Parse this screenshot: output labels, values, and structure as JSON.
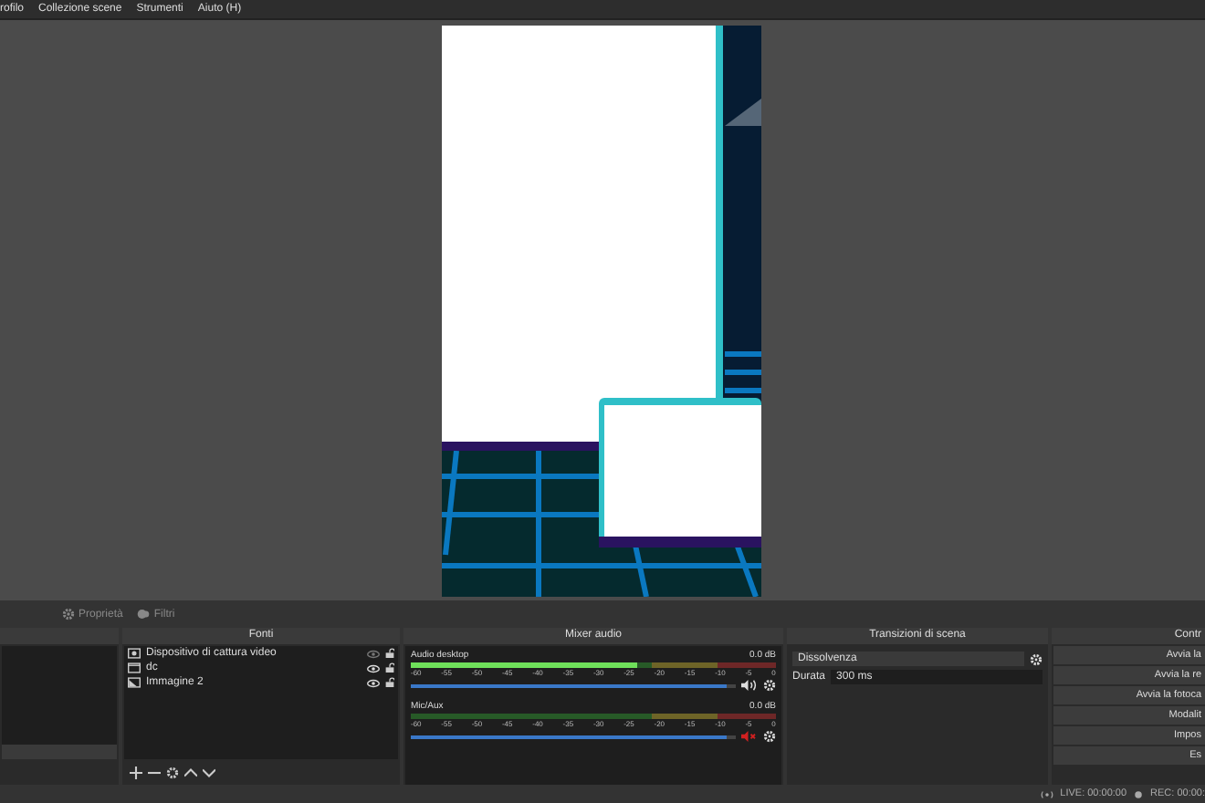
{
  "menu": [
    "rofilo",
    "Collezione scene",
    "Strumenti",
    "Aiuto (H)"
  ],
  "toolbar": [
    {
      "label": "Proprietà",
      "disabled": true,
      "kind": "gear"
    },
    {
      "label": "Filtri",
      "disabled": true,
      "kind": "filter"
    }
  ],
  "sources": {
    "title": "Fonti",
    "items": [
      {
        "name": "Dispositivo di cattura video",
        "kind": "video",
        "visible": false,
        "locked": false
      },
      {
        "name": "dc",
        "kind": "window",
        "visible": true,
        "locked": false
      },
      {
        "name": "Immagine 2",
        "kind": "image",
        "visible": true,
        "locked": false
      }
    ]
  },
  "mixer": {
    "title": "Mixer audio",
    "channels": [
      {
        "name": "Audio desktop",
        "reading": "0.0 dB",
        "meter": {
          "level": 0.62
        },
        "scale": [
          "-60",
          "-55",
          "-50",
          "-45",
          "-40",
          "-35",
          "-30",
          "-25",
          "-20",
          "-15",
          "-10",
          "-5",
          "0"
        ],
        "volume": {
          "level": 0.97
        },
        "muted": false
      },
      {
        "name": "Mic/Aux",
        "reading": "0.0 dB",
        "scale": [
          "-60",
          "-55",
          "-50",
          "-45",
          "-40",
          "-35",
          "-30",
          "-25",
          "-20",
          "-15",
          "-10",
          "-5",
          "0"
        ],
        "volume": {
          "level": 0.97
        },
        "muted": true
      }
    ]
  },
  "transitions": {
    "title": "Transizioni di scena",
    "selected": "Dissolvenza",
    "duration_label": "Durata",
    "duration": "300 ms"
  },
  "controls": {
    "title": "Contr",
    "buttons": [
      "Avvia la",
      "Avvia la re",
      "Avvia la fotoca",
      "Modalit",
      "Impos",
      "Es"
    ]
  },
  "status": {
    "live": "LIVE: 00:00:00",
    "rec": "REC: 00:00:"
  }
}
